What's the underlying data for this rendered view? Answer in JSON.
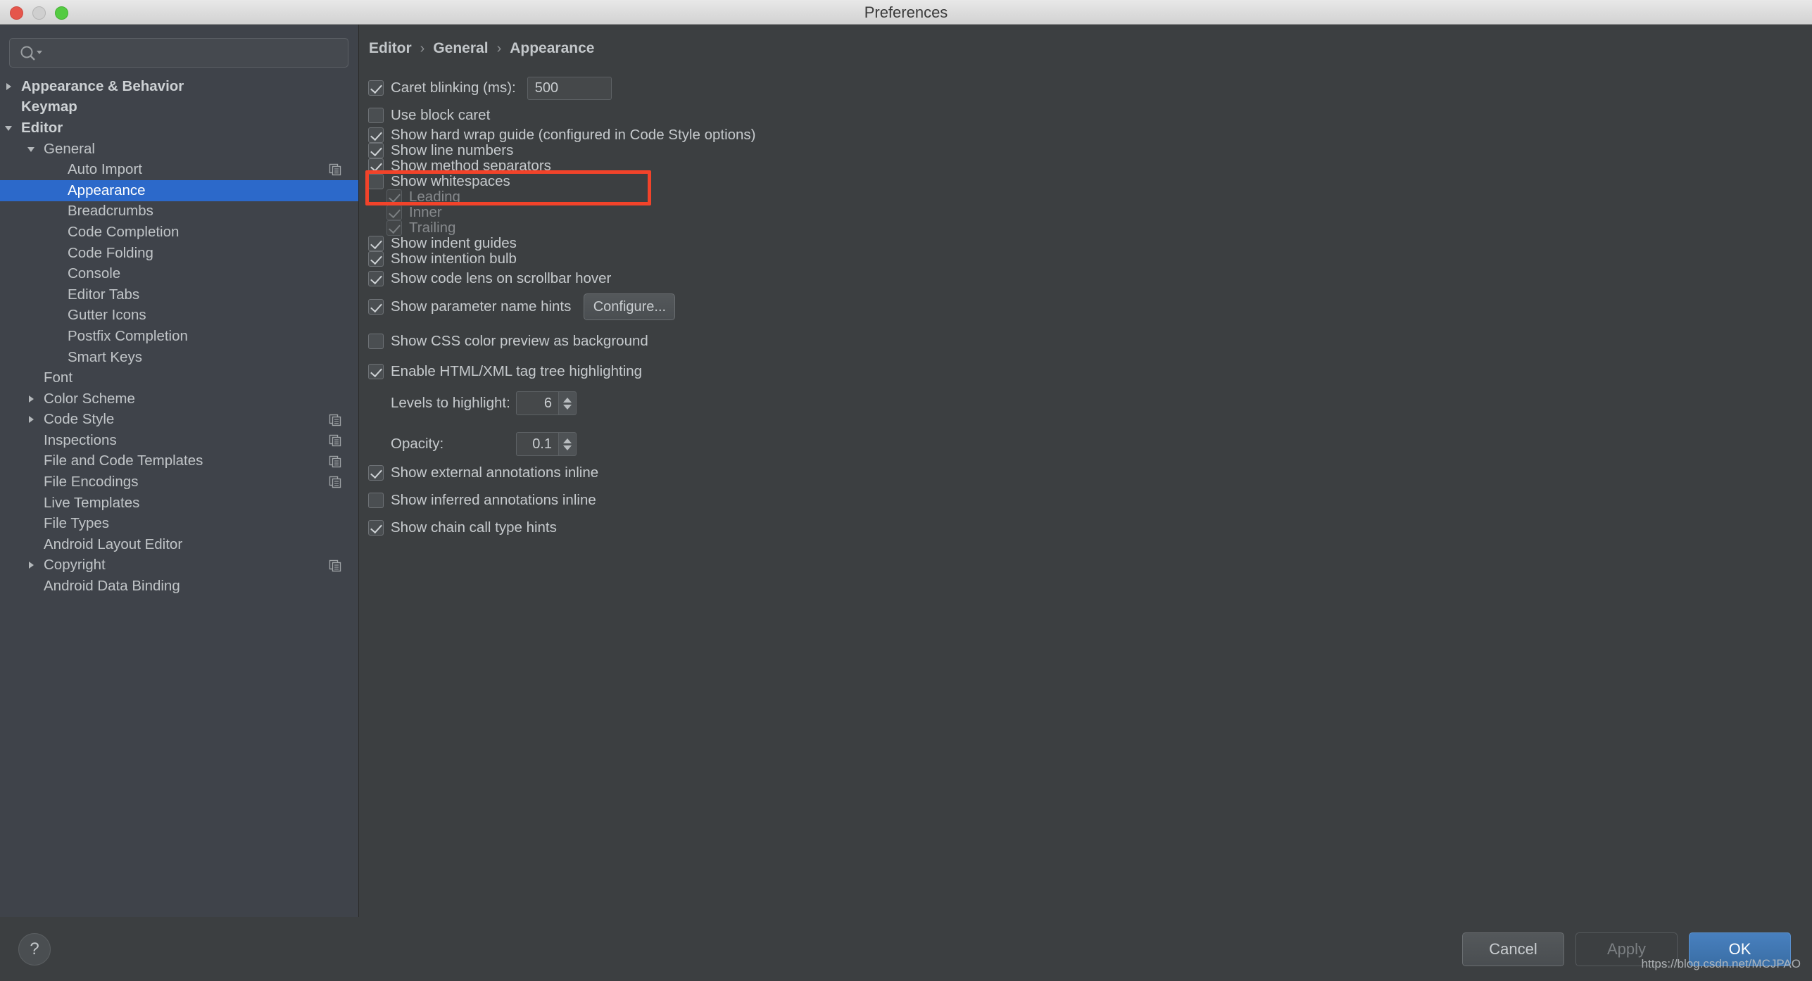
{
  "window": {
    "title": "Preferences"
  },
  "search": {
    "value": "",
    "placeholder": ""
  },
  "sidebar": {
    "items": [
      {
        "label": "Appearance & Behavior",
        "depth": 0,
        "twisty": "collapsed",
        "bold": true,
        "selected": false,
        "icon": null
      },
      {
        "label": "Keymap",
        "depth": 0,
        "twisty": "none",
        "bold": true,
        "selected": false,
        "icon": null
      },
      {
        "label": "Editor",
        "depth": 0,
        "twisty": "expanded",
        "bold": true,
        "selected": false,
        "icon": null
      },
      {
        "label": "General",
        "depth": 1,
        "twisty": "expanded",
        "bold": false,
        "selected": false,
        "icon": null
      },
      {
        "label": "Auto Import",
        "depth": 2,
        "twisty": "none",
        "bold": false,
        "selected": false,
        "icon": "copy-icon"
      },
      {
        "label": "Appearance",
        "depth": 2,
        "twisty": "none",
        "bold": false,
        "selected": true,
        "icon": null
      },
      {
        "label": "Breadcrumbs",
        "depth": 2,
        "twisty": "none",
        "bold": false,
        "selected": false,
        "icon": null
      },
      {
        "label": "Code Completion",
        "depth": 2,
        "twisty": "none",
        "bold": false,
        "selected": false,
        "icon": null
      },
      {
        "label": "Code Folding",
        "depth": 2,
        "twisty": "none",
        "bold": false,
        "selected": false,
        "icon": null
      },
      {
        "label": "Console",
        "depth": 2,
        "twisty": "none",
        "bold": false,
        "selected": false,
        "icon": null
      },
      {
        "label": "Editor Tabs",
        "depth": 2,
        "twisty": "none",
        "bold": false,
        "selected": false,
        "icon": null
      },
      {
        "label": "Gutter Icons",
        "depth": 2,
        "twisty": "none",
        "bold": false,
        "selected": false,
        "icon": null
      },
      {
        "label": "Postfix Completion",
        "depth": 2,
        "twisty": "none",
        "bold": false,
        "selected": false,
        "icon": null
      },
      {
        "label": "Smart Keys",
        "depth": 2,
        "twisty": "none",
        "bold": false,
        "selected": false,
        "icon": null
      },
      {
        "label": "Font",
        "depth": 1,
        "twisty": "none",
        "bold": false,
        "selected": false,
        "icon": null
      },
      {
        "label": "Color Scheme",
        "depth": 1,
        "twisty": "collapsed",
        "bold": false,
        "selected": false,
        "icon": null
      },
      {
        "label": "Code Style",
        "depth": 1,
        "twisty": "collapsed",
        "bold": false,
        "selected": false,
        "icon": "copy-icon"
      },
      {
        "label": "Inspections",
        "depth": 1,
        "twisty": "none",
        "bold": false,
        "selected": false,
        "icon": "copy-icon"
      },
      {
        "label": "File and Code Templates",
        "depth": 1,
        "twisty": "none",
        "bold": false,
        "selected": false,
        "icon": "copy-icon"
      },
      {
        "label": "File Encodings",
        "depth": 1,
        "twisty": "none",
        "bold": false,
        "selected": false,
        "icon": "copy-icon"
      },
      {
        "label": "Live Templates",
        "depth": 1,
        "twisty": "none",
        "bold": false,
        "selected": false,
        "icon": null
      },
      {
        "label": "File Types",
        "depth": 1,
        "twisty": "none",
        "bold": false,
        "selected": false,
        "icon": null
      },
      {
        "label": "Android Layout Editor",
        "depth": 1,
        "twisty": "none",
        "bold": false,
        "selected": false,
        "icon": null
      },
      {
        "label": "Copyright",
        "depth": 1,
        "twisty": "collapsed",
        "bold": false,
        "selected": false,
        "icon": "copy-icon"
      },
      {
        "label": "Android Data Binding",
        "depth": 1,
        "twisty": "none",
        "bold": false,
        "selected": false,
        "icon": null
      }
    ]
  },
  "main": {
    "breadcrumb": {
      "part1": "Editor",
      "sep1": "›",
      "part2": "General",
      "sep2": "›",
      "part3": "Appearance"
    },
    "options": {
      "caret_blinking": {
        "label": "Caret blinking (ms):",
        "checked": true,
        "value": "500"
      },
      "use_block_caret": {
        "label": "Use block caret",
        "checked": false
      },
      "show_hard_wrap_guide": {
        "label": "Show hard wrap guide (configured in Code Style options)",
        "checked": true
      },
      "show_line_numbers": {
        "label": "Show line numbers",
        "checked": true
      },
      "show_method_separators": {
        "label": "Show method separators",
        "checked": true,
        "highlighted": true
      },
      "show_whitespaces": {
        "label": "Show whitespaces",
        "checked": false
      },
      "leading": {
        "label": "Leading",
        "checked": true,
        "disabled": true
      },
      "inner": {
        "label": "Inner",
        "checked": true,
        "disabled": true
      },
      "trailing": {
        "label": "Trailing",
        "checked": true,
        "disabled": true
      },
      "show_indent_guides": {
        "label": "Show indent guides",
        "checked": true
      },
      "show_intention_bulb": {
        "label": "Show intention bulb",
        "checked": true
      },
      "show_code_lens": {
        "label": "Show code lens on scrollbar hover",
        "checked": true
      },
      "show_parameter_name_hints": {
        "label": "Show parameter name hints",
        "checked": true,
        "button": "Configure..."
      },
      "show_css_color_preview": {
        "label": "Show CSS color preview as background",
        "checked": false
      },
      "enable_tag_tree_highlighting": {
        "label": "Enable HTML/XML tag tree highlighting",
        "checked": true
      },
      "levels_to_highlight": {
        "label": "Levels to highlight:",
        "value": "6"
      },
      "opacity": {
        "label": "Opacity:",
        "value": "0.1"
      },
      "show_external_annotations": {
        "label": "Show external annotations inline",
        "checked": true
      },
      "show_inferred_annotations": {
        "label": "Show inferred annotations inline",
        "checked": false
      },
      "show_chain_call_type_hints": {
        "label": "Show chain call type hints",
        "checked": true
      }
    }
  },
  "footer": {
    "help": "?",
    "cancel": "Cancel",
    "apply": "Apply",
    "ok": "OK"
  },
  "watermark": "https://blog.csdn.net/MCJPAO",
  "colors": {
    "selection_blue": "#2c69ca",
    "primary_button": "#3a6ea5",
    "annotation_red": "#f2432a",
    "sidebar_bg": "#3f434a",
    "main_bg": "#3c3f41"
  }
}
